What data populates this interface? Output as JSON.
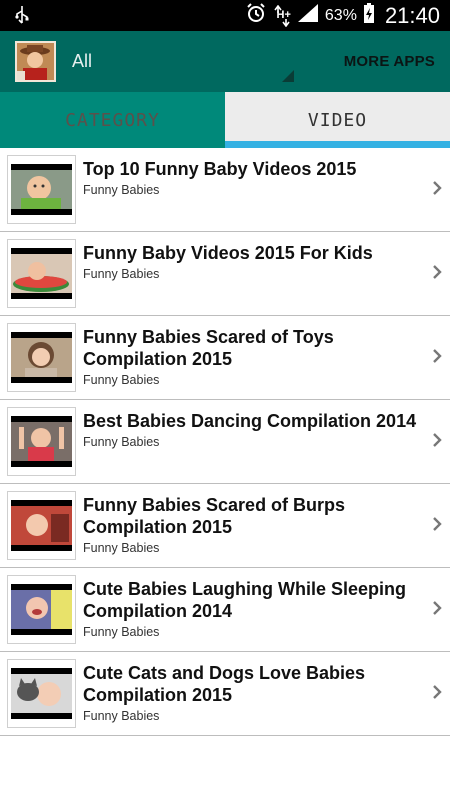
{
  "status_bar": {
    "icons": [
      "usb-icon",
      "alarm-icon",
      "hplus-data-icon",
      "signal-icon",
      "battery-charging-icon"
    ],
    "network_label": "H+",
    "battery_percent": "63%",
    "time": "21:40"
  },
  "action_bar": {
    "filter_label": "All",
    "more_apps_label": "MORE APPS"
  },
  "tabs": {
    "items": [
      {
        "label": "CATEGORY",
        "selected": false
      },
      {
        "label": "VIDEO",
        "selected": true
      }
    ],
    "indicator_color": "#34b1e3"
  },
  "colors": {
    "action_bar": "#00695f",
    "tab_category_bg": "#00897a",
    "tab_video_bg": "#ececec"
  },
  "videos": [
    {
      "title": "Top 10 Funny Baby Videos 2015",
      "channel": "Funny Babies"
    },
    {
      "title": "Funny Baby Videos 2015 For Kids",
      "channel": "Funny Babies"
    },
    {
      "title": "Funny Babies Scared of Toys Compilation 2015",
      "channel": "Funny Babies"
    },
    {
      "title": "Best Babies Dancing Compilation 2014",
      "channel": "Funny Babies"
    },
    {
      "title": "Funny Babies Scared of Burps Compilation 2015",
      "channel": "Funny Babies"
    },
    {
      "title": "Cute Babies Laughing While Sleeping Compilation 2014",
      "channel": "Funny Babies"
    },
    {
      "title": "Cute Cats and Dogs Love Babies Compilation 2015",
      "channel": "Funny Babies"
    }
  ]
}
